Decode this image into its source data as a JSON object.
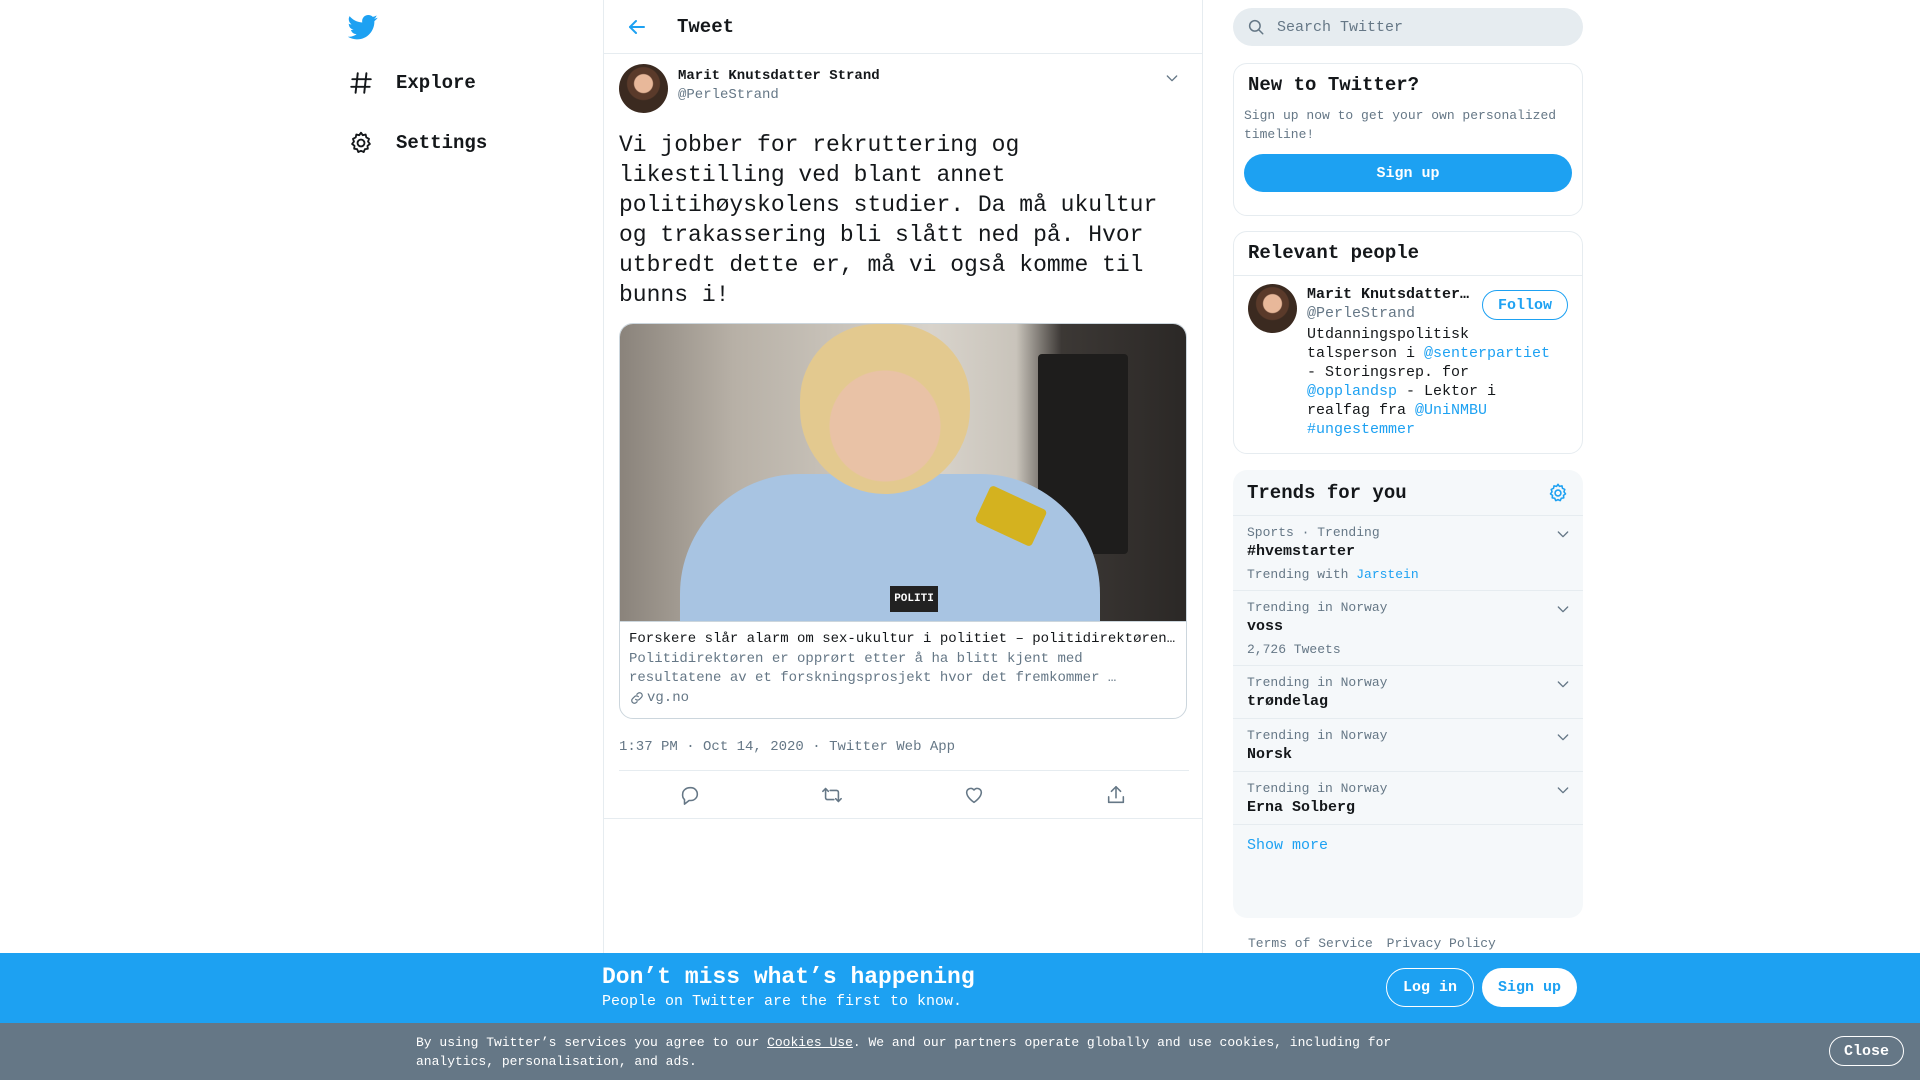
{
  "nav": {
    "items": [
      {
        "label": "Explore",
        "icon": "hashtag-icon"
      },
      {
        "label": "Settings",
        "icon": "gear-icon"
      }
    ]
  },
  "header": {
    "title": "Tweet"
  },
  "tweet": {
    "author_name": "Marit Knutsdatter Strand",
    "author_handle": "@PerleStrand",
    "text": "Vi jobber for rekruttering og likestilling ved blant annet politihøyskolens studier. Da må ukultur og trakassering bli slått ned på. Hvor utbredt dette er, må vi også komme til bunns i!",
    "card": {
      "image_badge": "POLITI",
      "title": "Forskere slår alarm om sex-ukultur i politiet – politidirektøren: Gjør meg veldig ...",
      "description": "Politidirektøren er opprørt etter å ha blitt kjent med resultatene av et forskningsprosjekt hvor det fremkommer …",
      "domain": "vg.no"
    },
    "time": "1:37 PM · Oct 14, 2020",
    "separator": "·",
    "source": "Twitter Web App"
  },
  "search": {
    "placeholder": "Search Twitter"
  },
  "new_to_twitter": {
    "title": "New to Twitter?",
    "subtitle": "Sign up now to get your own personalized timeline!",
    "signup_label": "Sign up"
  },
  "relevant_people": {
    "title": "Relevant people",
    "person": {
      "name": "Marit Knutsdatter Strand",
      "handle": "@PerleStrand",
      "follow_label": "Follow",
      "bio": {
        "t1": "Utdanningspolitisk talsperson i ",
        "m1": "@senterpartiet",
        "t2": " - Storingsrep. for ",
        "m2": "@opplandsp",
        "t3": " - Lektor i realfag fra ",
        "m3": "@UniNMBU",
        "t4": " ",
        "h1": "#ungestemmer"
      }
    }
  },
  "trends": {
    "title": "Trends for you",
    "items": [
      {
        "context": "Sports · Trending",
        "name": "#hvemstarter",
        "extra_prefix": "Trending with ",
        "extra_link": "Jarstein"
      },
      {
        "context": "Trending in Norway",
        "name": "voss",
        "extra_prefix": "2,726 Tweets",
        "extra_link": ""
      },
      {
        "context": "Trending in Norway",
        "name": "trøndelag"
      },
      {
        "context": "Trending in Norway",
        "name": "Norsk"
      },
      {
        "context": "Trending in Norway",
        "name": "Erna Solberg"
      }
    ],
    "show_more": "Show more"
  },
  "footer": {
    "terms": "Terms of Service",
    "privacy": "Privacy Policy"
  },
  "bottom_bar": {
    "title": "Don’t miss what’s happening",
    "subtitle": "People on Twitter are the first to know.",
    "login_label": "Log in",
    "signup_label": "Sign up"
  },
  "cookie": {
    "text_before": "By using Twitter’s services you agree to our ",
    "link": "Cookies Use",
    "text_after": ". We and our partners operate globally and use cookies, including for analytics, personalisation, and ads.",
    "close_label": "Close"
  },
  "colors": {
    "accent": "#1da1f2",
    "secondary_text": "#657786",
    "border": "#e6ecf0",
    "cookie_bg": "#657786"
  }
}
